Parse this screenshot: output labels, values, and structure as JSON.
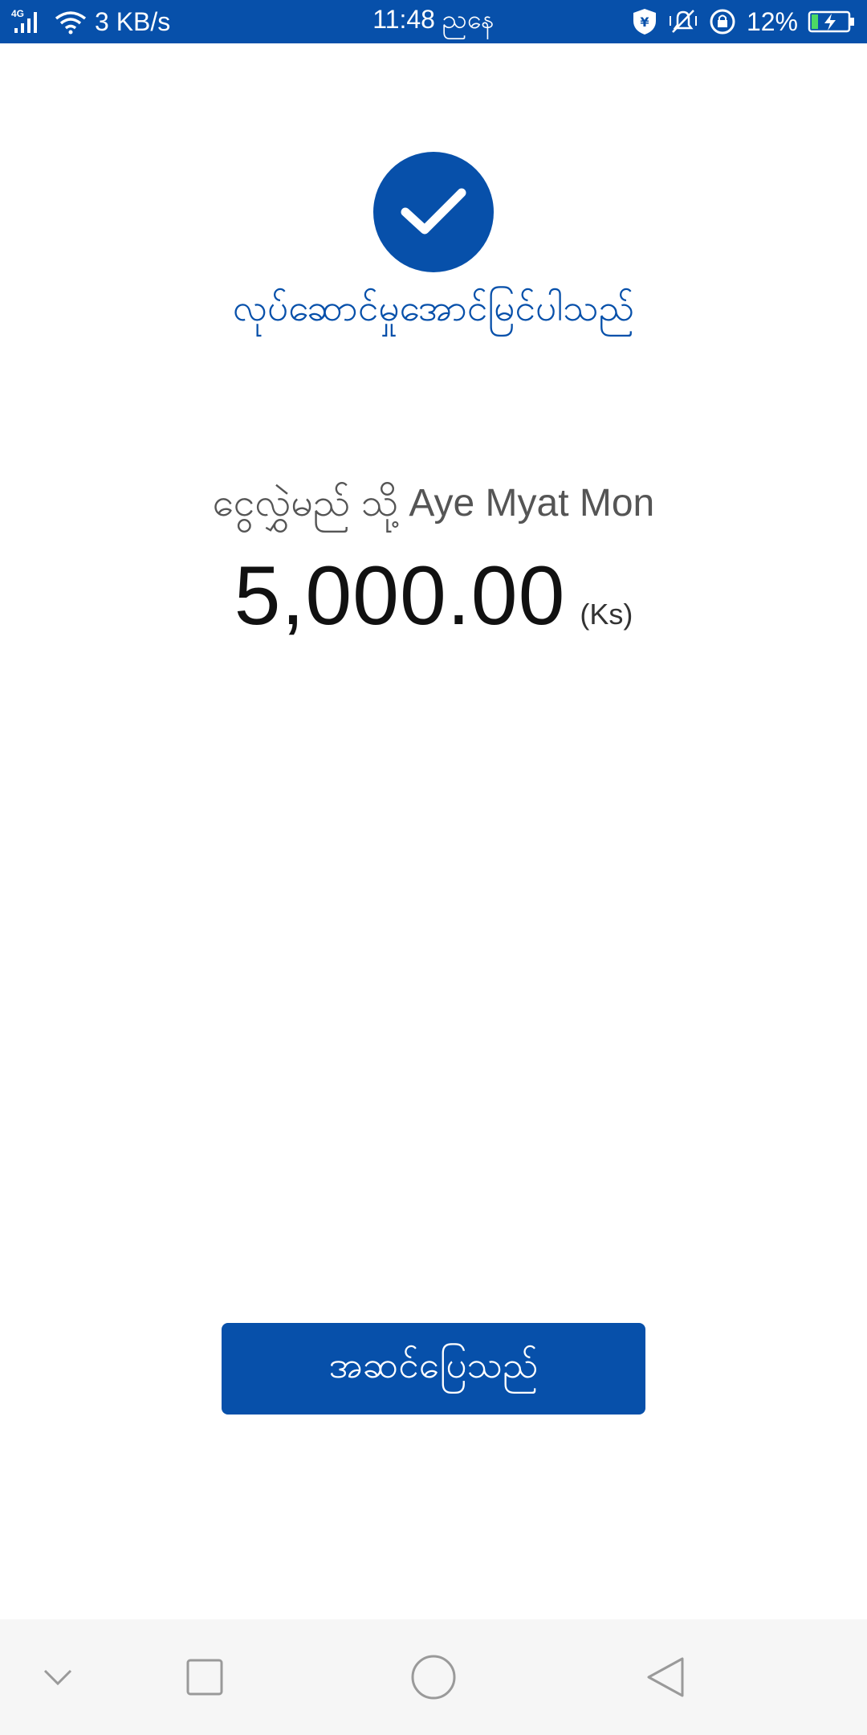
{
  "status_bar": {
    "network_label": "4G",
    "speed": "3 KB/s",
    "time": "11:48 ညနေ",
    "battery": "12%"
  },
  "success": {
    "icon": "checkmark-icon",
    "title": "လုပ်ဆောင်မှုအောင်မြင်ပါသည်"
  },
  "transfer": {
    "recipient_prefix": "ငွေလွှဲမည် သို့",
    "recipient_name": "Aye Myat Mon",
    "amount": "5,000.00",
    "currency": "(Ks)"
  },
  "actions": {
    "done_label": "အဆင်ပြေသည်"
  },
  "nav_bar": {
    "icons": [
      "chevron-down-icon",
      "recent-apps-icon",
      "home-icon",
      "back-icon"
    ]
  },
  "colors": {
    "primary": "#0750aa",
    "background": "#ffffff",
    "nav_background": "#f6f6f6"
  }
}
